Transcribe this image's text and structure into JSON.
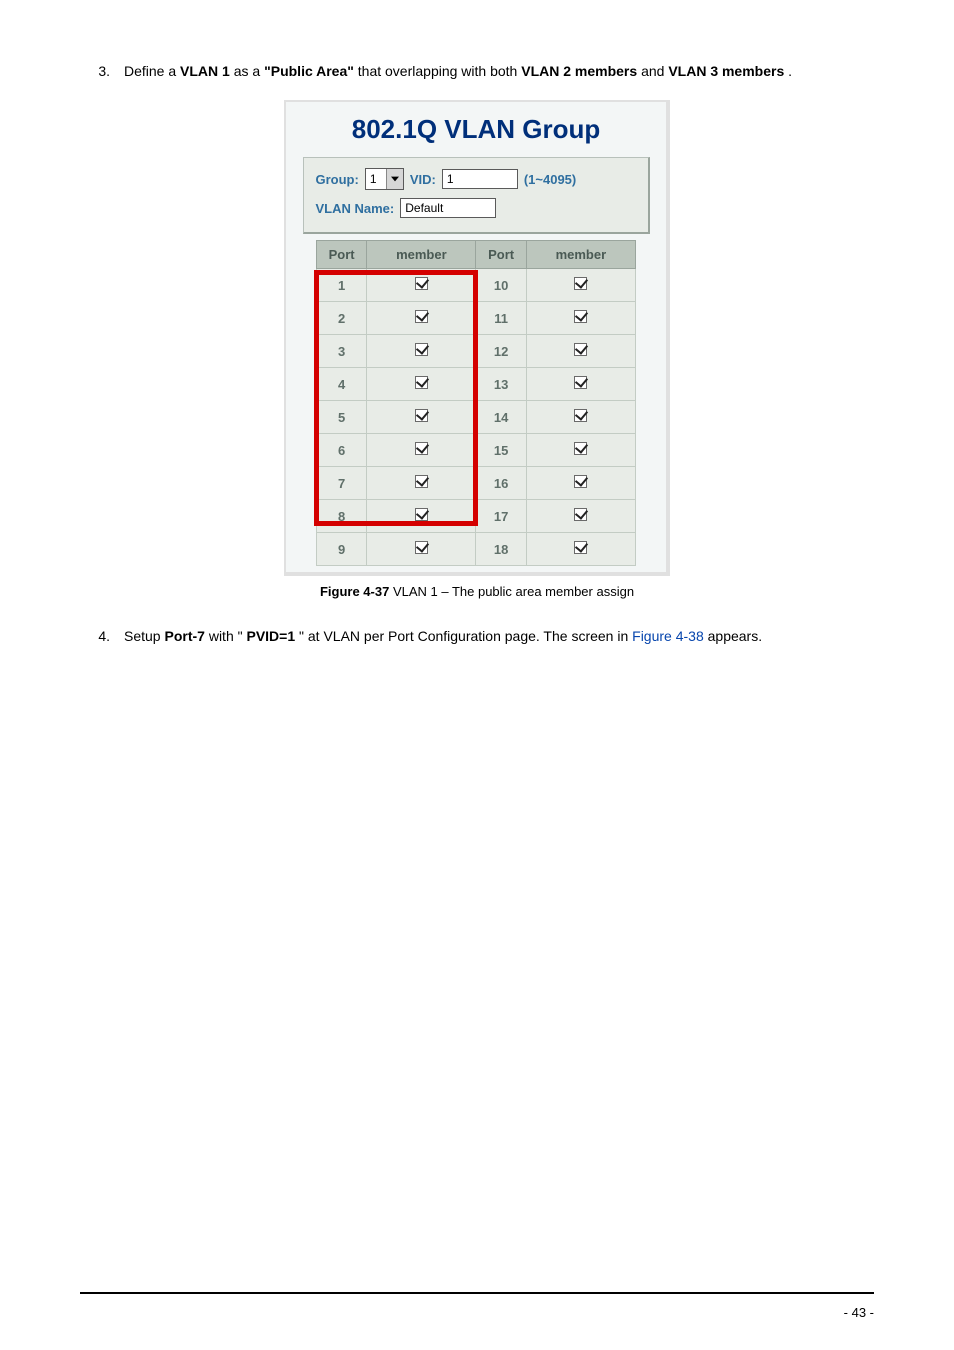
{
  "steps": {
    "s3": {
      "num": "3.",
      "t1": "Define a ",
      "b1": "VLAN 1",
      "t2": " as a ",
      "b2": "\"Public Area\"",
      "t3": " that overlapping with both ",
      "b3": "VLAN 2 members",
      "t4": " and ",
      "b4": "VLAN 3 members",
      "t5": "."
    },
    "s4": {
      "num": "4.",
      "t1": "Setup ",
      "b1": "Port-7",
      "t2": " with \"",
      "b2": "PVID=1",
      "t3": "\" at VLAN per Port Configuration page. The screen in ",
      "link": "Figure 4-38",
      "t4": " appears."
    }
  },
  "panel": {
    "title": "802.1Q VLAN Group",
    "labels": {
      "group": "Group:",
      "vid": "VID:",
      "range": "(1~4095)",
      "vlanName": "VLAN Name:"
    },
    "values": {
      "groupSelect": "1",
      "vidInput": "1",
      "vlanNameInput": "Default"
    },
    "headers": {
      "port": "Port",
      "member": "member"
    },
    "rows": [
      {
        "pL": "1",
        "mL": true,
        "pR": "10",
        "mR": true
      },
      {
        "pL": "2",
        "mL": true,
        "pR": "11",
        "mR": true
      },
      {
        "pL": "3",
        "mL": true,
        "pR": "12",
        "mR": true
      },
      {
        "pL": "4",
        "mL": true,
        "pR": "13",
        "mR": true
      },
      {
        "pL": "5",
        "mL": true,
        "pR": "14",
        "mR": true
      },
      {
        "pL": "6",
        "mL": true,
        "pR": "15",
        "mR": true
      },
      {
        "pL": "7",
        "mL": true,
        "pR": "16",
        "mR": true
      },
      {
        "pL": "8",
        "mL": true,
        "pR": "17",
        "mR": true
      },
      {
        "pL": "9",
        "mL": true,
        "pR": "18",
        "mR": true
      }
    ]
  },
  "caption": {
    "b": "Figure 4-37",
    "t": " VLAN 1 – The public area member assign"
  },
  "pageNumber": "- 43 -"
}
